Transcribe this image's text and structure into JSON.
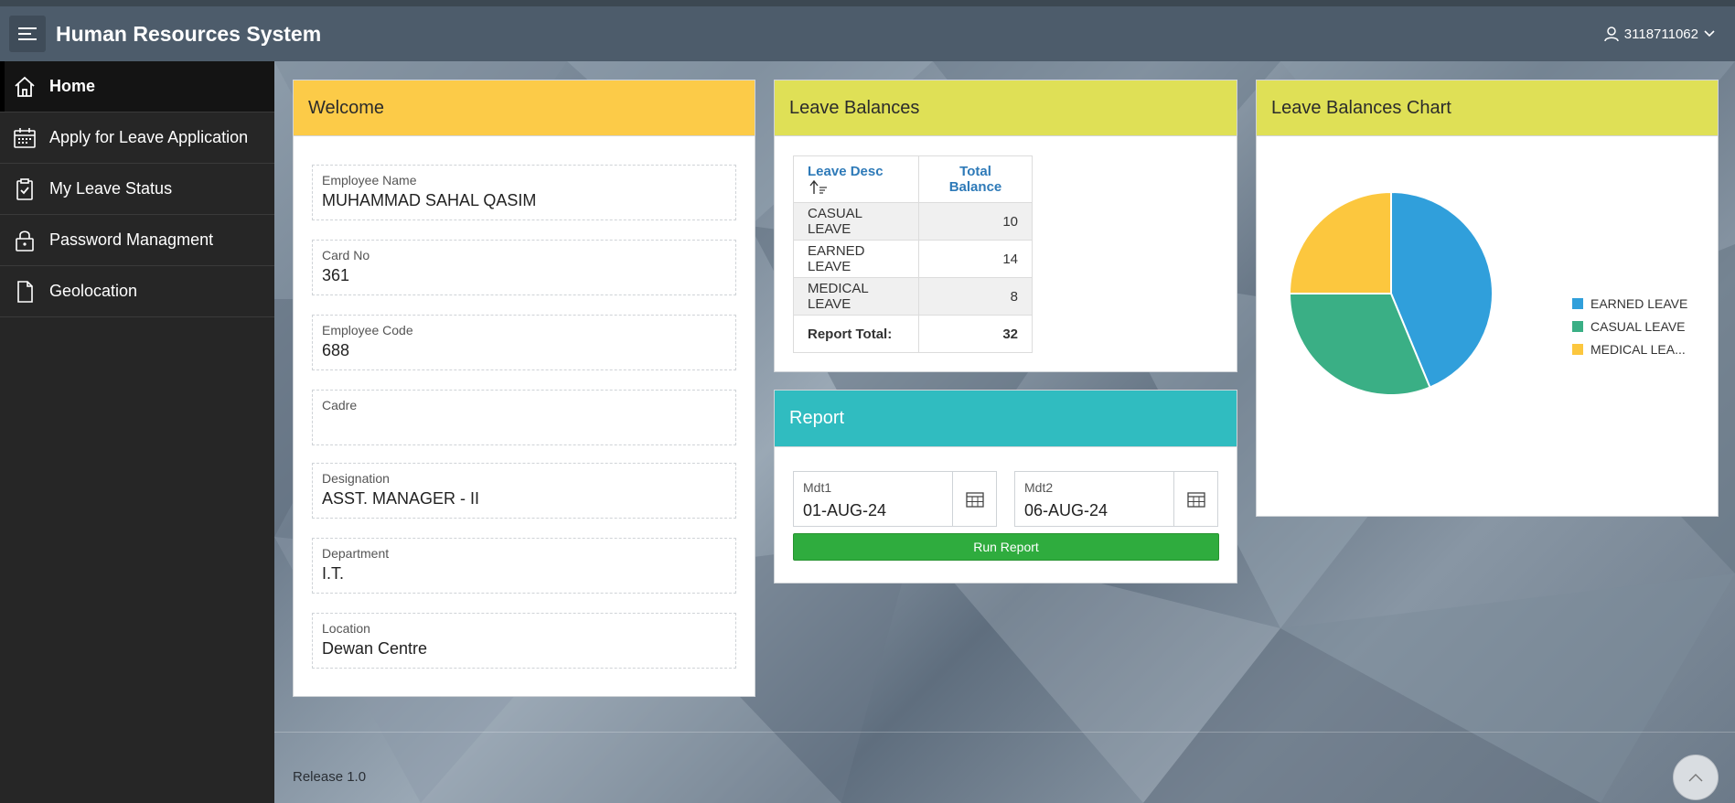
{
  "app": {
    "title": "Human Resources System",
    "user": "3118711062"
  },
  "sidebar": {
    "items": [
      {
        "label": "Home",
        "icon": "home-icon",
        "active": true
      },
      {
        "label": "Apply for Leave Application",
        "icon": "calendar-icon"
      },
      {
        "label": "My Leave Status",
        "icon": "clipboard-check-icon"
      },
      {
        "label": "Password Managment",
        "icon": "lock-icon"
      },
      {
        "label": "Geolocation",
        "icon": "document-icon"
      }
    ]
  },
  "welcome": {
    "title": "Welcome",
    "fields": [
      {
        "label": "Employee Name",
        "value": "MUHAMMAD SAHAL QASIM"
      },
      {
        "label": "Card No",
        "value": "361"
      },
      {
        "label": "Employee Code",
        "value": "688"
      },
      {
        "label": "Cadre",
        "value": ""
      },
      {
        "label": "Designation",
        "value": "ASST. MANAGER - II"
      },
      {
        "label": "Department",
        "value": "I.T."
      },
      {
        "label": "Location",
        "value": "Dewan Centre"
      }
    ]
  },
  "leave_balances": {
    "title": "Leave Balances",
    "columns": [
      "Leave Desc",
      "Total Balance"
    ],
    "rows": [
      {
        "desc": "CASUAL LEAVE",
        "balance": "10"
      },
      {
        "desc": "EARNED LEAVE",
        "balance": "14"
      },
      {
        "desc": "MEDICAL LEAVE",
        "balance": "8"
      }
    ],
    "total_label": "Report Total:",
    "total_value": "32"
  },
  "report": {
    "title": "Report",
    "mdt1_label": "Mdt1",
    "mdt1_value": "01-AUG-24",
    "mdt2_label": "Mdt2",
    "mdt2_value": "06-AUG-24",
    "run_label": "Run Report"
  },
  "chart_card": {
    "title": "Leave Balances Chart"
  },
  "chart_data": {
    "type": "pie",
    "categories": [
      "EARNED LEAVE",
      "CASUAL LEAVE",
      "MEDICAL LEAVE"
    ],
    "legend_labels": [
      "EARNED LEAVE",
      "CASUAL LEAVE",
      "MEDICAL LEA..."
    ],
    "values": [
      14,
      10,
      8
    ],
    "colors": [
      "#309fdb",
      "#3aaf85",
      "#fcc73e"
    ],
    "legend": "right"
  },
  "footer": {
    "release": "Release 1.0"
  }
}
